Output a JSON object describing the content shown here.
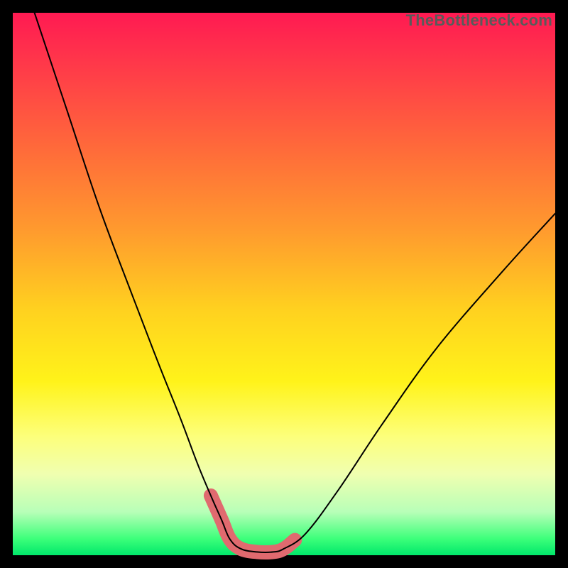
{
  "watermark": "TheBottleneck.com",
  "chart_data": {
    "type": "line",
    "title": "",
    "xlabel": "",
    "ylabel": "",
    "xlim": [
      0,
      100
    ],
    "ylim": [
      0,
      100
    ],
    "grid": false,
    "annotations": [
      "TheBottleneck.com"
    ],
    "series": [
      {
        "name": "curve",
        "x": [
          4,
          10,
          16,
          22,
          27,
          31,
          34,
          36.5,
          38.5,
          40,
          42,
          45,
          48,
          50,
          54,
          60,
          68,
          78,
          90,
          100
        ],
        "y": [
          100,
          82,
          64,
          48,
          35,
          25,
          17,
          11,
          6.5,
          3,
          1.2,
          0.6,
          0.6,
          1.2,
          4,
          12,
          24,
          38,
          52,
          63
        ]
      },
      {
        "name": "highlight-band",
        "x": [
          36.5,
          38.5,
          40,
          42,
          45,
          48,
          50,
          52
        ],
        "y": [
          11,
          6.5,
          3,
          1.2,
          0.6,
          0.6,
          1.2,
          2.8
        ]
      }
    ],
    "background_gradient": {
      "top": "#ff1a52",
      "mid": "#fff31a",
      "bottom": "#00e86a"
    }
  }
}
